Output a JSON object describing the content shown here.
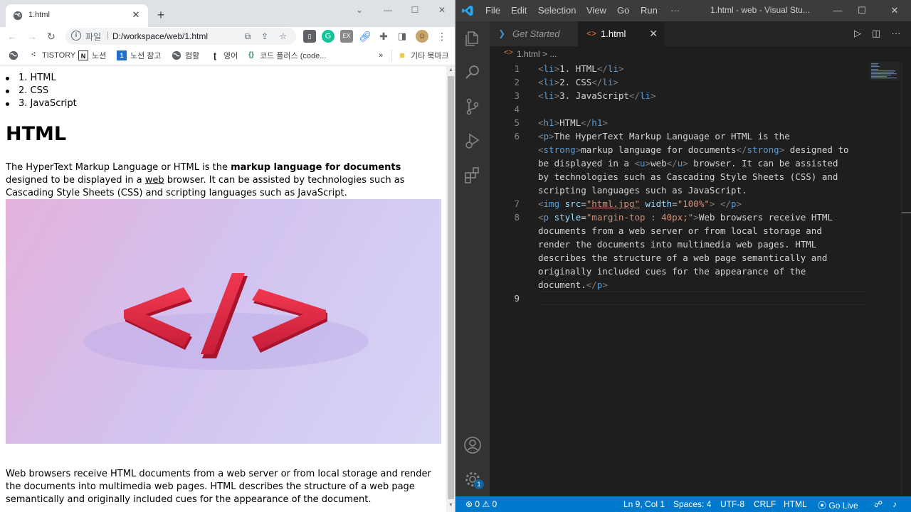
{
  "chrome": {
    "tab_title": "1.html",
    "address": {
      "scheme": "파일",
      "separator": "|",
      "url": "D:/workspace/web/1.html"
    },
    "bookmarks": [
      {
        "label": "",
        "icon": "globe-icon"
      },
      {
        "label": "TISTORY",
        "icon": "tistory-icon"
      },
      {
        "label": "노션",
        "icon": "notion-icon"
      },
      {
        "label": "노션 참고",
        "icon": "bookmark-1-icon"
      },
      {
        "label": "컴활",
        "icon": "globe-icon"
      },
      {
        "label": "영어",
        "icon": "t-icon"
      },
      {
        "label": "코드 플러스 (code...",
        "icon": "code-icon"
      }
    ],
    "bookmarks_overflow": "»",
    "other_bookmarks": "기타 북마크",
    "page": {
      "list": [
        "1. HTML",
        "2. CSS",
        "3. JavaScript"
      ],
      "heading": "HTML",
      "para_before": "The HyperText Markup Language or HTML is the ",
      "para_strong": "markup language for documents",
      "para_mid": " designed to be displayed in a ",
      "para_u": "web",
      "para_after": " browser. It can be assisted by technologies such as Cascading Style Sheets (CSS) and scripting languages such as JavaScript.",
      "para2": "Web browsers receive HTML documents from a web server or from local storage and render the documents into multimedia web pages. HTML describes the structure of a web page semantically and originally included cues for the appearance of the document."
    }
  },
  "vscode": {
    "menu": [
      "File",
      "Edit",
      "Selection",
      "View",
      "Go",
      "Run",
      "···"
    ],
    "window_title": "1.html - web - Visual Stu...",
    "tabs": [
      {
        "label": "Get Started",
        "active": false
      },
      {
        "label": "1.html",
        "active": true
      }
    ],
    "breadcrumb": "1.html > ...",
    "line_numbers": [
      "1",
      "2",
      "3",
      "4",
      "5",
      "6",
      "7",
      "8",
      "9"
    ],
    "code": {
      "l1_text": "1. HTML",
      "l2_text": "2. CSS",
      "l3_text": "3. JavaScript",
      "l5_text": "HTML",
      "l6_a": "The HyperText Markup Language or HTML is the",
      "l6_strong": "markup language for documents",
      "l6_b": " designed to",
      "l6_c": "be displayed in a ",
      "l6_u": "web",
      "l6_d": " browser. It can be assisted",
      "l6_e": "by technologies such as Cascading Style Sheets (CSS) and",
      "l6_f": "scripting languages such as JavaScript.",
      "l7_src": "\"html.jpg\"",
      "l7_width": "\"100%\"",
      "l8_style": "\"margin-top : 40px;\"",
      "l8_a": "Web browsers receive HTML",
      "l8_b": "documents from a web server or from local storage and",
      "l8_c": "render the documents into multimedia web pages. HTML",
      "l8_d": "describes the structure of a web page semantically and",
      "l8_e": "originally included cues for the appearance of the",
      "l8_f": "document."
    },
    "status": {
      "errors": "0",
      "warnings": "0",
      "position": "Ln 9, Col 1",
      "spaces": "Spaces: 4",
      "encoding": "UTF-8",
      "eol": "CRLF",
      "language": "HTML",
      "golive": "Go Live"
    },
    "accounts_badge": "1"
  }
}
